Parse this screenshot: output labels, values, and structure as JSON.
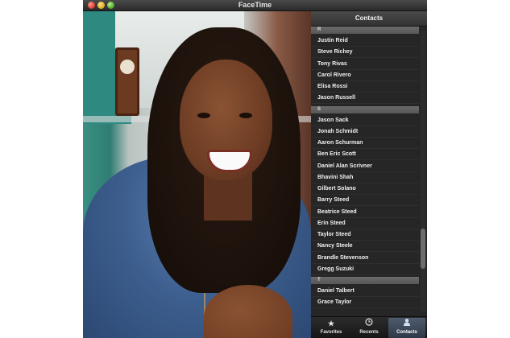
{
  "window": {
    "title": "FaceTime"
  },
  "panel": {
    "header": "Contacts"
  },
  "sections": [
    {
      "letter": "R",
      "contacts": [
        "Justin Reid",
        "Steve Richey",
        "Tony Rivas",
        "Carol Rivero",
        "Elisa Rossi",
        "Jason Russell"
      ]
    },
    {
      "letter": "S",
      "contacts": [
        "Jason Sack",
        "Jonah Schmidt",
        "Aaron Schurman",
        "Ben Eric Scott",
        "Daniel Alan Scrivner",
        "Bhavini Shah",
        "Gilbert Solano",
        "Barry Steed",
        "Beatrice Steed",
        "Erin Steed",
        "Taylor Steed",
        "Nancy Steele",
        "Brandle Stevenson",
        "Gregg Suzuki"
      ]
    },
    {
      "letter": "T",
      "contacts": [
        "Daniel Talbert",
        "Grace Taylor"
      ]
    }
  ],
  "tabs": [
    {
      "label": "Favorites",
      "icon": "star-icon",
      "active": false
    },
    {
      "label": "Recents",
      "icon": "clock-icon",
      "active": false
    },
    {
      "label": "Contacts",
      "icon": "person-icon",
      "active": true
    }
  ],
  "scroll": {
    "position_fraction": 0.82
  }
}
